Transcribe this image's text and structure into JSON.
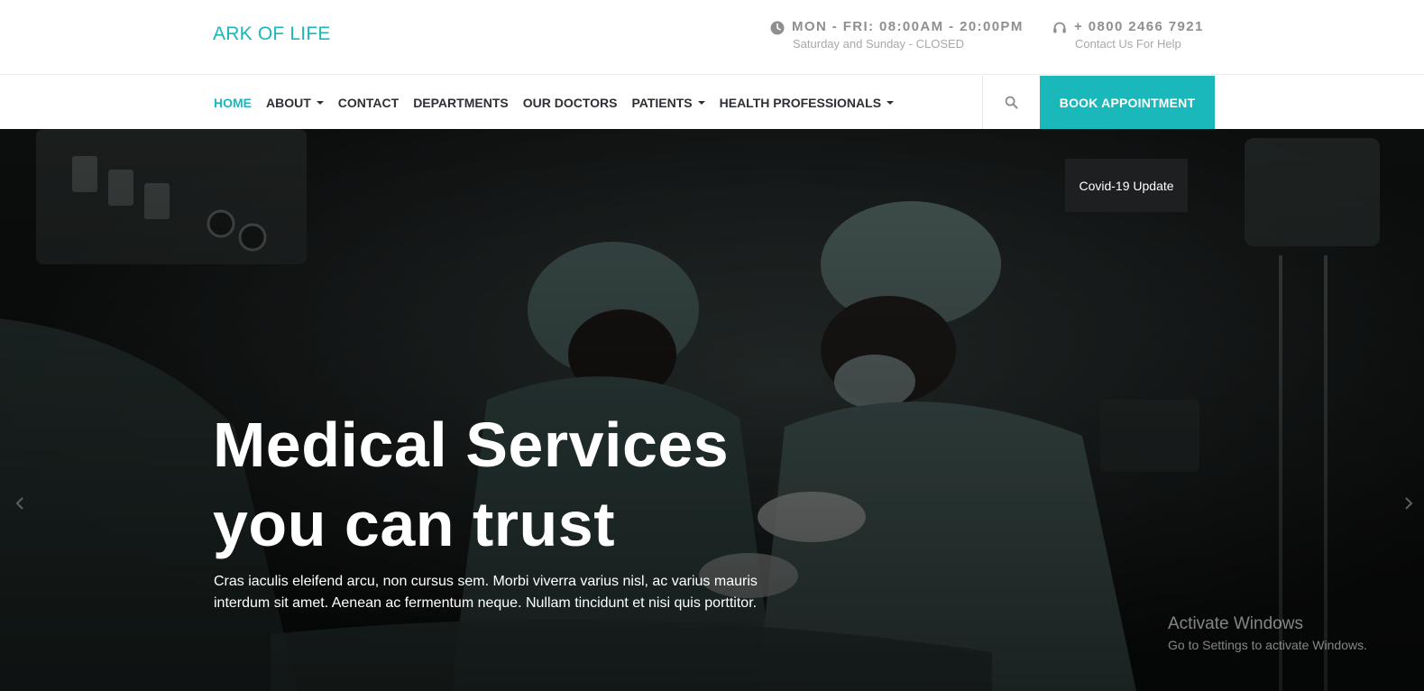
{
  "brand": {
    "name": "ARK OF LIFE",
    "color": "#1ab7bb"
  },
  "topbar": {
    "hours": {
      "icon": "clock-icon",
      "title": "MON - FRI: 08:00AM - 20:00PM",
      "subtitle": "Saturday and Sunday - CLOSED"
    },
    "phone": {
      "icon": "headset-icon",
      "title": "+ 0800 2466 7921",
      "subtitle": "Contact Us For Help"
    }
  },
  "nav": {
    "items": [
      {
        "label": "HOME",
        "active": true,
        "dropdown": false
      },
      {
        "label": "ABOUT",
        "active": false,
        "dropdown": true
      },
      {
        "label": "CONTACT",
        "active": false,
        "dropdown": false
      },
      {
        "label": "DEPARTMENTS",
        "active": false,
        "dropdown": false
      },
      {
        "label": "OUR DOCTORS",
        "active": false,
        "dropdown": false
      },
      {
        "label": "PATIENTS",
        "active": false,
        "dropdown": true
      },
      {
        "label": "HEALTH PROFESSIONALS",
        "active": false,
        "dropdown": true
      }
    ],
    "search_icon": "search-icon",
    "book_label": "BOOK APPOINTMENT"
  },
  "hero": {
    "title_line1": "Medical Services",
    "title_line2": "you can trust",
    "text_line1": "Cras iaculis eleifend arcu, non cursus sem. Morbi viverra varius nisl, ac varius mauris",
    "text_line2": "interdum sit amet. Aenean ac fermentum neque. Nullam tincidunt et nisi quis porttitor.",
    "covid_label": "Covid-19 Update",
    "prev_icon": "chevron-left-icon",
    "next_icon": "chevron-right-icon"
  },
  "watermark": {
    "title": "Activate Windows",
    "subtitle": "Go to Settings to activate Windows."
  },
  "colors": {
    "accent": "#1ab7bb",
    "text_dark": "#2d3035",
    "muted": "#8d8f93"
  }
}
